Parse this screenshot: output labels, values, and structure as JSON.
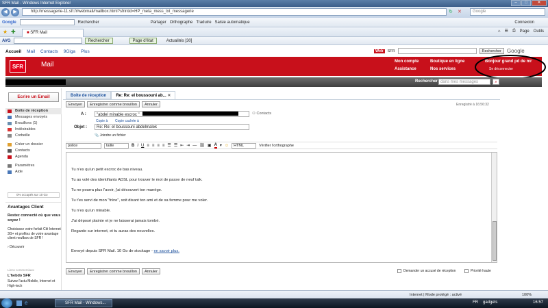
{
  "window": {
    "title": "SFR Mail - Windows Internet Explorer"
  },
  "address_bar": {
    "url": "http://messagerie-11.sfr.fr/webmail/mailbox.html?sfrintid=HP_meta_mess_txt_messagerie",
    "search_placeholder": "Google"
  },
  "google_toolbar": {
    "label": "Google",
    "rechercher": "Rechercher",
    "partager": "Partager",
    "orthographe": "Orthographe",
    "traduire": "Traduire",
    "saisie": "Saisie automatique",
    "connexion": "Connexion"
  },
  "avg_toolbar": {
    "label": "AVG",
    "rechercher": "Rechercher",
    "page_etat": "Page d'état",
    "actualites": "Actualités [30]"
  },
  "browser_tab": {
    "label": "SFR Mail"
  },
  "ie_commands": {
    "page": "Page",
    "outils": "Outils"
  },
  "site": {
    "top_links": [
      "Accueil",
      "Mail",
      "Contacts",
      "9Giga",
      "Plus"
    ],
    "web_label": "Web",
    "sfr_label": "SFR",
    "rechercher": "Rechercher",
    "google": "Google",
    "logo": "SFR",
    "mail_title": "Mail",
    "mon_compte": "Mon compte",
    "assistance": "Assistance",
    "boutique": "Boutique en ligne",
    "services": "Nos services",
    "bonjour": "Bonjour grand pd de mr",
    "deconnecter": "Se déconnecter",
    "search_label": "Rechercher",
    "search_placeholder": "dans mes messages"
  },
  "sidebar": {
    "compose": "Ecrire un Email",
    "items": [
      {
        "label": "Boîte de réception"
      },
      {
        "label": "Messages envoyés"
      },
      {
        "label": "Brouillons",
        "count": "(1)"
      },
      {
        "label": "Indésirables"
      },
      {
        "label": "Corbeille"
      },
      {
        "label": "Créer un dossier"
      },
      {
        "label": "Contacts"
      },
      {
        "label": "Agenda"
      },
      {
        "label": "Paramètres"
      },
      {
        "label": "Aide"
      }
    ],
    "quota": "0% occupés sur 10 Go",
    "advantages_title": "Avantages Client",
    "adv_headline": "Restez connecté où que vous soyez !",
    "adv_text": "Choisissez votre forfait Clé Internet 3G+ et profitez de votre avantage client neufbox de SFR !",
    "adv_link": "Découvrir",
    "sponsored": "Liens commerciaux",
    "hebdo_title": "L'hebdo SFR",
    "hebdo_text": "Suivez l'actu Mobile, Internet et High-tech"
  },
  "compose": {
    "tab_inbox": "Boîte de réception",
    "tab_current": "Re: Re: el boussouni ab...",
    "envoyer": "Envoyer",
    "brouillon": "Enregistrer comme brouillon",
    "annuler": "Annuler",
    "saved": "Enregistré à 16:56:32",
    "to_label": "A :",
    "to_value": "\"abdel minable escroc \"",
    "contacts": "Contacts",
    "copie": "Copie à",
    "copie_cachee": "Copie cachée à",
    "subject_label": "Objet :",
    "subject_value": "Re: Re: el boussouni abdelmalek",
    "attach": "Joindre un fichier",
    "font": "police",
    "size": "taille",
    "html": "HTML",
    "spell": "Vérifier l'orthographe",
    "body": [
      "Tu n'es qu'un petit escroc de bas niveau.",
      "Tu as volé des identifiants ADSL pour trouver le mot de passe de neuf talk.",
      "Tu ne pourra plus l'avoir, j'ai découvert ton manège.",
      "Tu t'es servi de mon \"frère\", soit disant ton ami et de sa femme pour me voler.",
      "Tu n'es qu'un minable.",
      "J'ai déposé plainte et je ne laisserai jamais tombé.",
      "Regarde sur internet, et tu auras des nouvelles."
    ],
    "signature": "Envoyé depuis SFR Mail. 10 Go de stockage -",
    "signature_link": "en savoir plus.",
    "receipt": "Demander un accusé de réception",
    "priority": "Priorité haute"
  },
  "status": {
    "zone": "Internet | Mode protégé : activé",
    "zoom": "100%"
  },
  "taskbar": {
    "task": "SFR Mail - Windows...",
    "gadgets": "gadgets",
    "lang": "FR",
    "time": "16:57"
  }
}
